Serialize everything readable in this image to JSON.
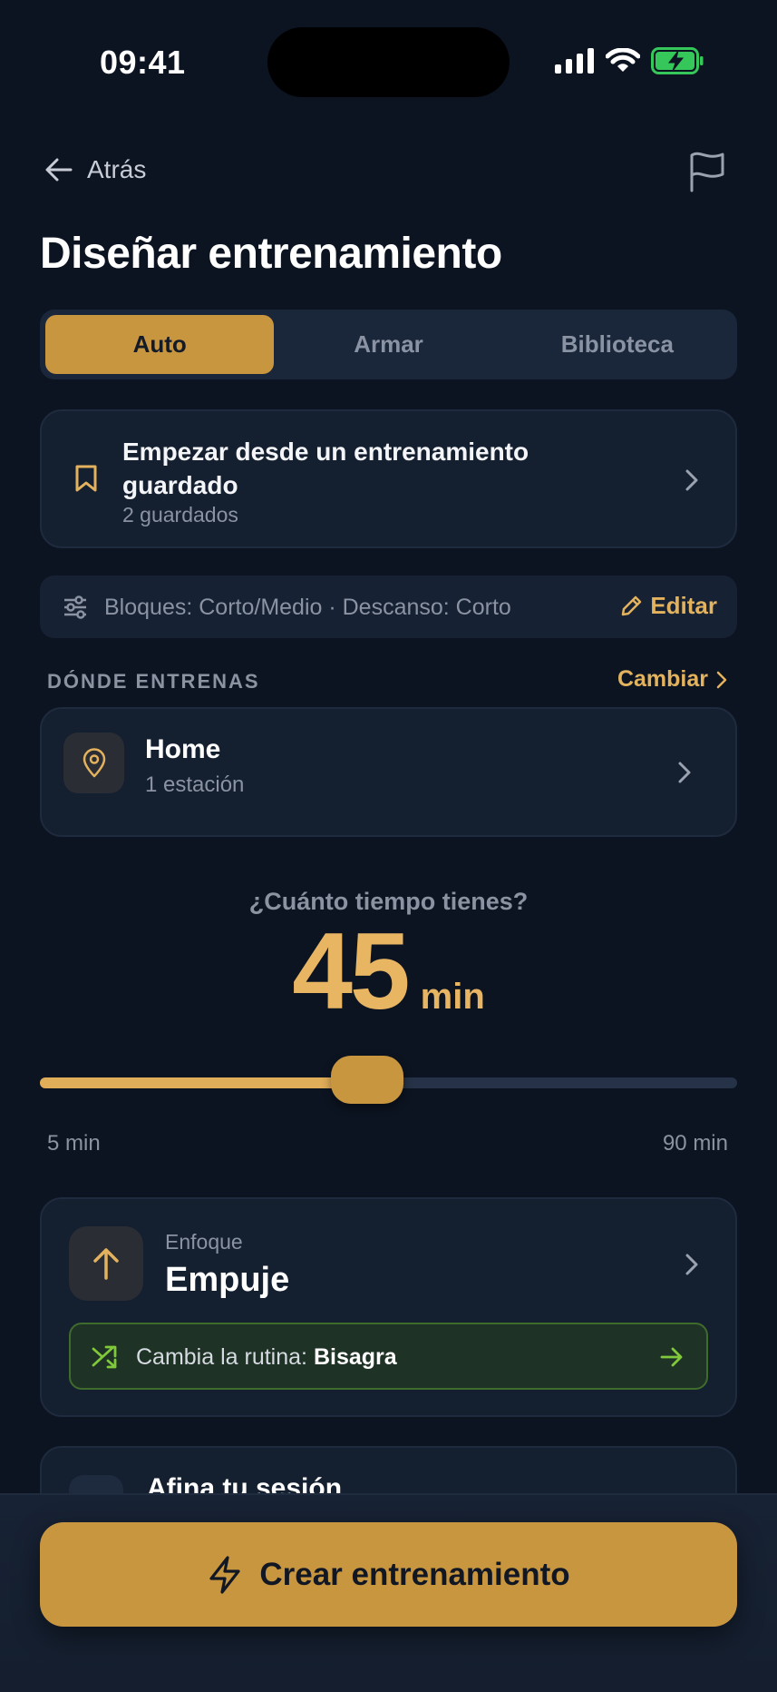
{
  "status_bar": {
    "time": "09:41"
  },
  "nav": {
    "back_label": "Atrás"
  },
  "title": "Diseñar entrenamiento",
  "tabs": [
    {
      "label": "Auto",
      "active": true
    },
    {
      "label": "Armar",
      "active": false
    },
    {
      "label": "Biblioteca",
      "active": false
    }
  ],
  "saved": {
    "title": "Empezar desde un entrenamiento guardado",
    "subtitle": "2 guardados"
  },
  "preferences": {
    "summary": "Bloques: Corto/Medio · Descanso: Corto",
    "edit_label": "Editar"
  },
  "location": {
    "section_label": "DÓNDE ENTRENAS",
    "change_label": "Cambiar",
    "name": "Home",
    "stations": "1 estación"
  },
  "duration": {
    "question": "¿Cuánto tiempo tienes?",
    "value": "45",
    "unit": "min",
    "min_label": "5 min",
    "max_label": "90 min",
    "slider_fraction": 0.47
  },
  "focus": {
    "label": "Enfoque",
    "value": "Empuje",
    "switch_prefix": "Cambia la rutina: ",
    "switch_target": "Bisagra"
  },
  "tune": {
    "title": "Afina tu sesión"
  },
  "cta": {
    "label": "Crear entrenamiento"
  },
  "colors": {
    "background": "#0c1421",
    "accent": "#c99640",
    "accent_text": "#e3b25e",
    "card": "#141f30",
    "success": "#7fc93a"
  }
}
